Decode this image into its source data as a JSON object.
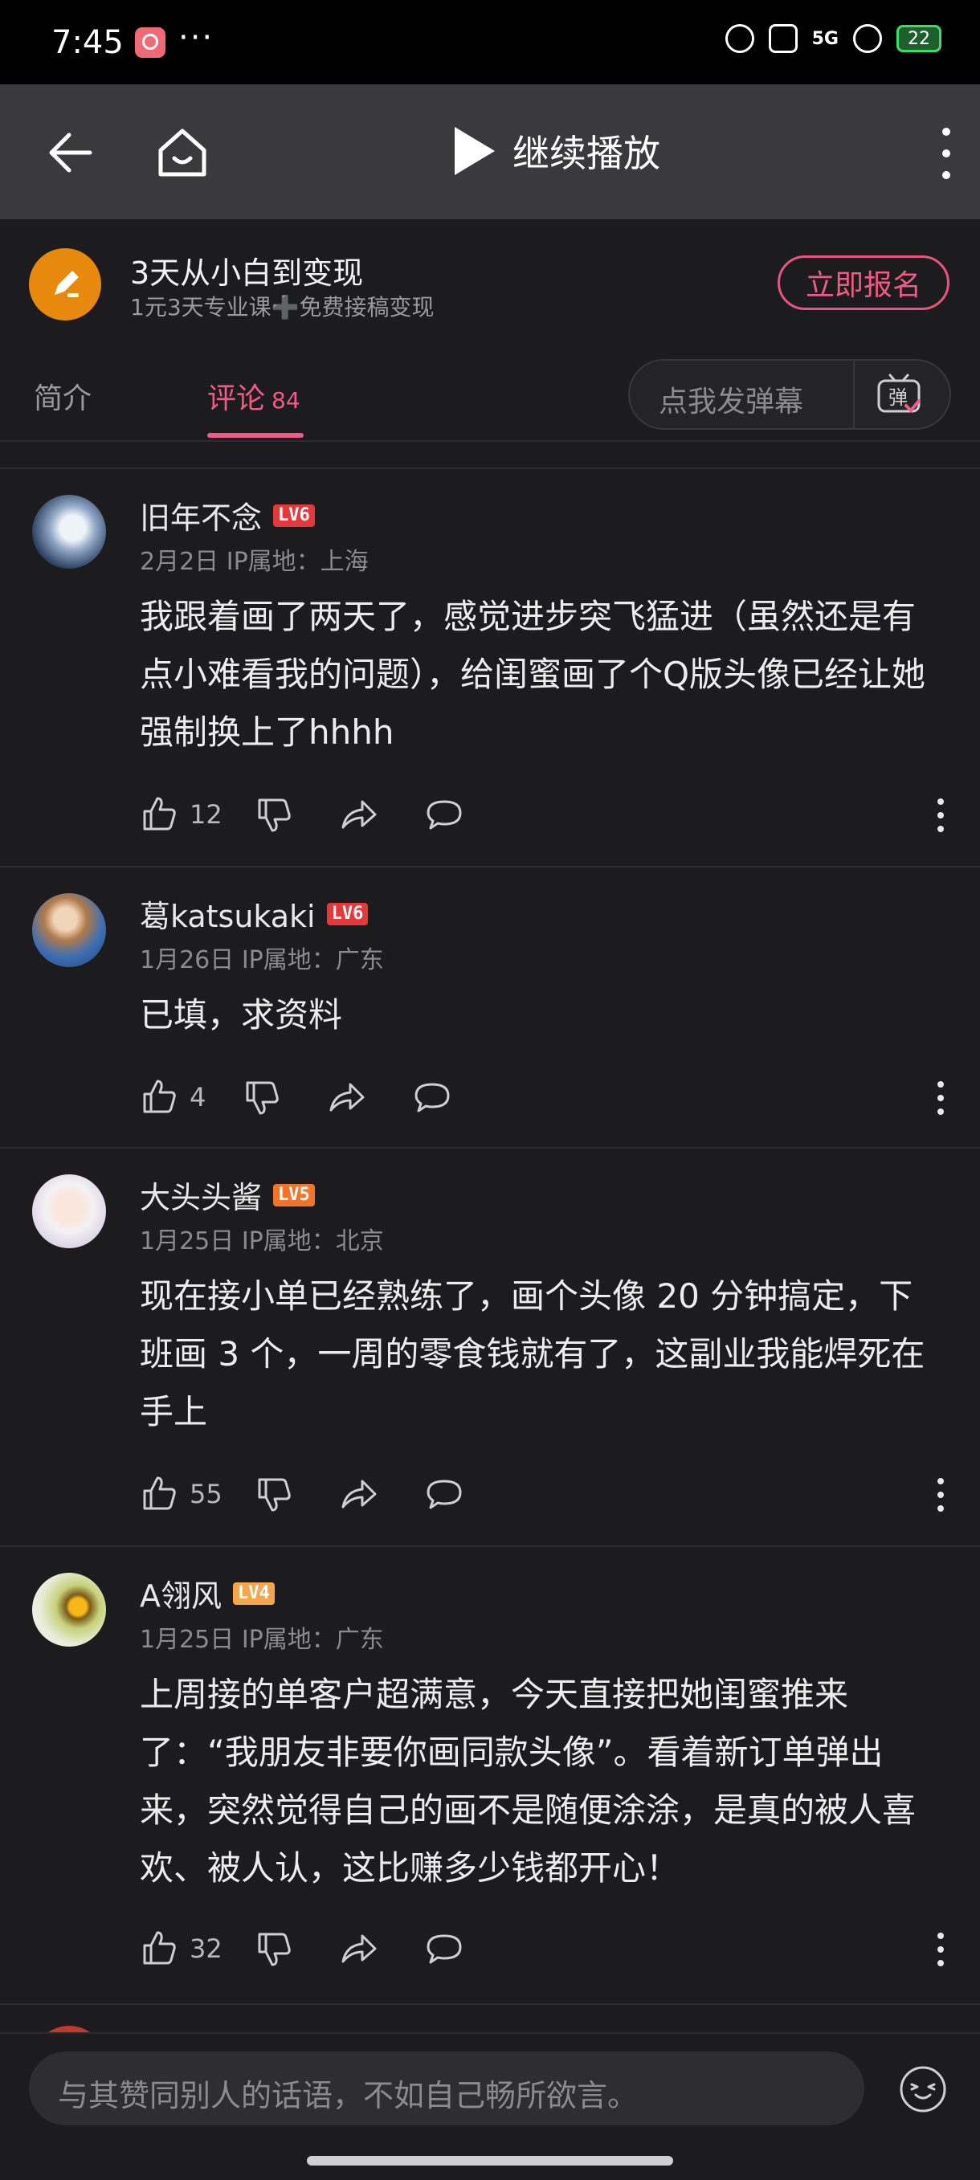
{
  "status_bar": {
    "time": "7:45",
    "dots": "···",
    "network": "5G",
    "battery": "22"
  },
  "header": {
    "play_label": "继续播放"
  },
  "promo": {
    "title": "3天从小白到变现",
    "subtitle": "1元3天专业课➕免费接稿变现",
    "button": "立即报名"
  },
  "tabs": {
    "intro": "简介",
    "comments": "评论",
    "comments_count": "84",
    "danmaku_placeholder": "点我发弹幕",
    "danmaku_icon_text": "弹"
  },
  "comments": [
    {
      "username": "旧年不念",
      "level": "LV6",
      "level_color": "#e5383b",
      "date": "2月2日",
      "ip": "IP属地：上海",
      "content": "我跟着画了两天了，感觉进步突飞猛进（虽然还是有点小难看我的问题），给闺蜜画了个Q版头像已经让她强制换上了hhhh",
      "likes": "12"
    },
    {
      "username": "葛katsukaki",
      "level": "LV6",
      "level_color": "#e5383b",
      "date": "1月26日",
      "ip": "IP属地：广东",
      "content": "已填，求资料",
      "likes": "4"
    },
    {
      "username": "大头头酱",
      "level": "LV5",
      "level_color": "#f0742a",
      "date": "1月25日",
      "ip": "IP属地：北京",
      "content": "现在接小单已经熟练了，画个头像 20 分钟搞定，下班画 3 个，一周的零食钱就有了，这副业我能焊死在手上",
      "likes": "55"
    },
    {
      "username": "A翎风",
      "level": "LV4",
      "level_color": "#f5a54a",
      "date": "1月25日",
      "ip": "IP属地：广东",
      "content": "上周接的单客户超满意，今天直接把她闺蜜推来了：“我朋友非要你画同款头像”。看着新订单弹出来，突然觉得自己的画不是随便涂涂，是真的被人喜欢、被人认，这比赚多少钱都开心！",
      "likes": "32"
    }
  ],
  "composer": {
    "placeholder": "与其赞同别人的话语，不如自己畅所欲言。"
  },
  "colors": {
    "accent": "#ef5a86",
    "promo_icon": "#e6890c"
  }
}
